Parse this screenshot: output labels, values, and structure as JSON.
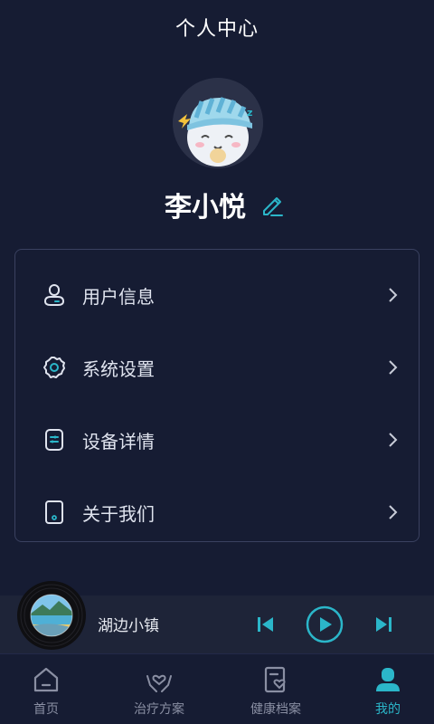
{
  "header": {
    "title": "个人中心"
  },
  "profile": {
    "name": "李小悦",
    "avatar_icon": "sleepy-cartoon-avatar",
    "edit_icon": "edit-pencil-icon"
  },
  "menu": {
    "items": [
      {
        "label": "用户信息",
        "icon": "user-info-icon"
      },
      {
        "label": "系统设置",
        "icon": "gear-icon"
      },
      {
        "label": "设备详情",
        "icon": "device-icon"
      },
      {
        "label": "关于我们",
        "icon": "phone-icon"
      }
    ]
  },
  "player": {
    "song_title": "湖边小镇",
    "state": "paused"
  },
  "tabs": [
    {
      "label": "首页",
      "icon": "home-icon",
      "active": false
    },
    {
      "label": "治疗方案",
      "icon": "care-hands-icon",
      "active": false
    },
    {
      "label": "健康档案",
      "icon": "health-record-icon",
      "active": false
    },
    {
      "label": "我的",
      "icon": "profile-icon",
      "active": true
    }
  ],
  "colors": {
    "background": "#161c33",
    "accent": "#2bb6c9",
    "card_border": "#3a4160",
    "text": "#dfe3ee",
    "muted": "#8a8fa3"
  }
}
